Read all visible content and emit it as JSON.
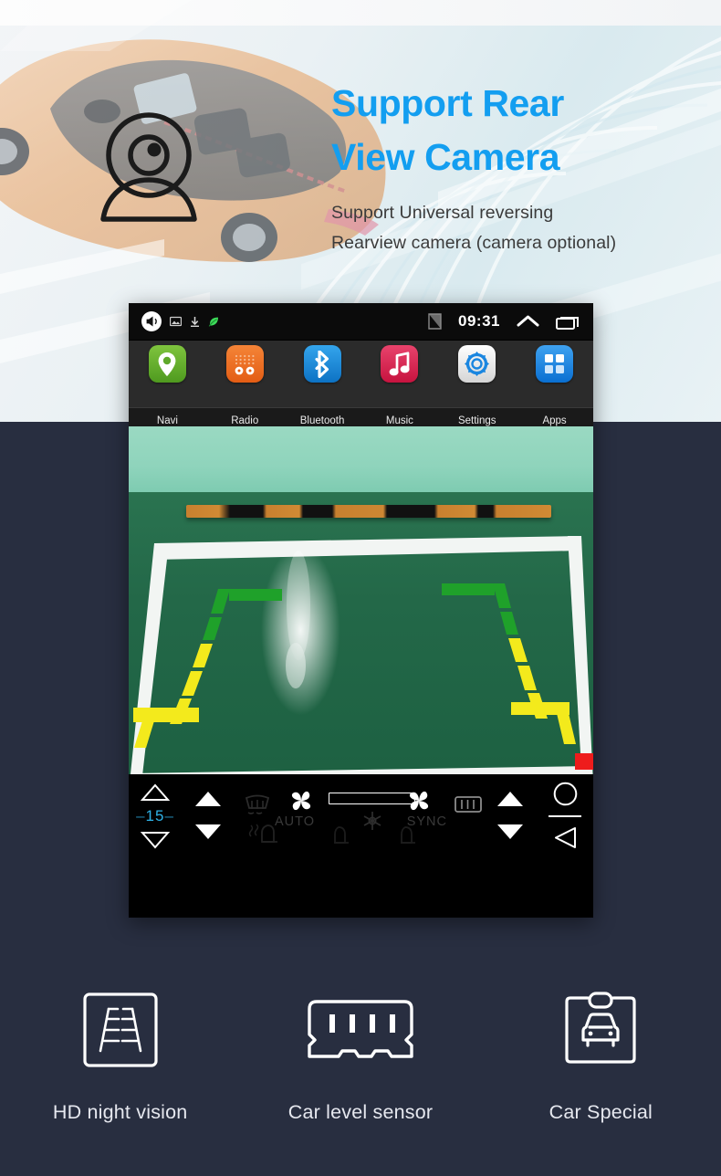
{
  "hero": {
    "title_line1": "Support Rear",
    "title_line2": "View Camera",
    "subtitle_line1": "Support Universal reversing",
    "subtitle_line2": "Rearview camera (camera optional)",
    "title_color": "#139ef0",
    "subtitle_color": "#3b3b3b",
    "icon": "rear-view-camera-icon",
    "background_art": "cutaway-car-illustration"
  },
  "panel": {
    "background_color": "#282e40"
  },
  "device": {
    "statusbar": {
      "time": "09:31",
      "left_icons": [
        "volume-speaker-icon",
        "screenshot-icon",
        "download-icon",
        "android-leaf-icon"
      ],
      "right_icons": [
        "sd-card-icon",
        "chevron-up-icon",
        "recents-icon"
      ]
    },
    "apps": [
      {
        "label": "Navi",
        "icon": "location-pin-icon",
        "color": "#5fa92a"
      },
      {
        "label": "Radio",
        "icon": "radio-grille-icon",
        "color": "#ef6b22"
      },
      {
        "label": "Bluetooth",
        "icon": "bluetooth-icon",
        "color": "#1a8fdd"
      },
      {
        "label": "Music",
        "icon": "music-note-icon",
        "color": "#d8264f"
      },
      {
        "label": "Settings",
        "icon": "gear-icon",
        "color": "#e8e8e8"
      },
      {
        "label": "Apps",
        "icon": "app-grid-icon",
        "color": "#1a86e0"
      }
    ],
    "camera_view": {
      "description": "rear-view-camera-live-feed",
      "guideline_colors": [
        "#1fa12a",
        "#f3ea1c",
        "#ee1c1c"
      ],
      "parking_line_color": "#ffffff",
      "floor_color": "#23684a",
      "wall_color": "#8fd4bc"
    },
    "climate": {
      "temperature": "15",
      "temperature_color": "#2fb3e8",
      "left_buttons": [
        "temp-up-outline-icon",
        "temp-down-outline-icon",
        "fan-up-icon",
        "fan-down-icon"
      ],
      "auto_label": "AUTO",
      "sync_label": "SYNC",
      "center_icons": [
        "front-defrost-icon",
        "fan-auto-icon",
        "seat-heater-left-icon",
        "seat-heater-right-icon",
        "snowflake-icon",
        "fan-sync-icon",
        "rear-defrost-icon"
      ],
      "right_buttons": [
        "volume-up-icon",
        "volume-down-icon",
        "home-circle-icon",
        "back-triangle-icon"
      ]
    }
  },
  "features": [
    {
      "label": "HD night vision",
      "icon": "parking-guideline-icon"
    },
    {
      "label": "Car level sensor",
      "icon": "level-sensor-module-icon"
    },
    {
      "label": "Car Special",
      "icon": "car-front-frame-icon"
    }
  ]
}
